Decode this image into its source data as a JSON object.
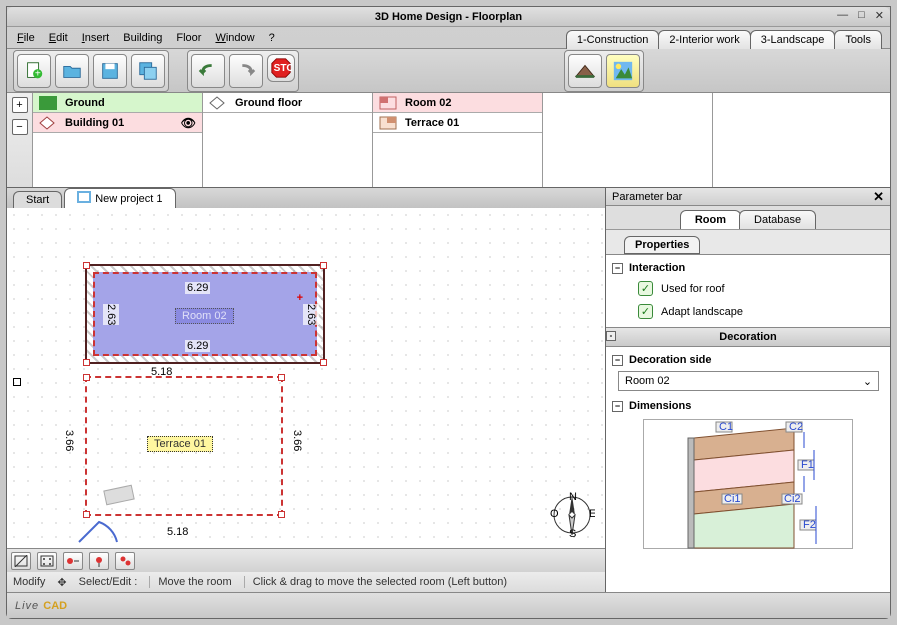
{
  "window": {
    "title": "3D Home Design - Floorplan"
  },
  "menu": {
    "file": "File",
    "edit": "Edit",
    "insert": "Insert",
    "building": "Building",
    "floor": "Floor",
    "window": "Window",
    "help": "?"
  },
  "modetabs": {
    "construction": "1-Construction",
    "interior": "2-Interior work",
    "landscape": "3-Landscape",
    "tools": "Tools"
  },
  "hierarchy": {
    "col1": {
      "ground": "Ground",
      "building": "Building 01"
    },
    "col2": {
      "groundfloor": "Ground floor"
    },
    "col3": {
      "room": "Room 02",
      "terrace": "Terrace 01"
    }
  },
  "worktabs": {
    "start": "Start",
    "project": "New project 1"
  },
  "plan": {
    "room_name": "Room 02",
    "terrace_name": "Terrace 01",
    "dims": {
      "w": "6.29",
      "h": "2.63",
      "tw": "5.18",
      "th": "3.66"
    }
  },
  "tooltabs": {
    "modify": "Modify",
    "select": "Select/Edit :"
  },
  "status": {
    "action": "Move the room",
    "hint": "Click & drag to move the selected room (Left button)"
  },
  "parambar": {
    "title": "Parameter bar",
    "tab_room": "Room",
    "tab_db": "Database",
    "subtab_props": "Properties",
    "grp_interaction": "Interaction",
    "chk_roof": "Used for roof",
    "chk_landscape": "Adapt landscape",
    "grp_decoration": "Decoration",
    "grp_decoside": "Decoration side",
    "select_val": "Room 02",
    "grp_dimensions": "Dimensions",
    "diagram": {
      "c1": "C1",
      "c2": "C2",
      "f1": "F1",
      "ci1": "Ci1",
      "ci2": "Ci2",
      "f2": "F2"
    }
  },
  "footer": {
    "logo1": "Live",
    "logo2": "CAD"
  }
}
